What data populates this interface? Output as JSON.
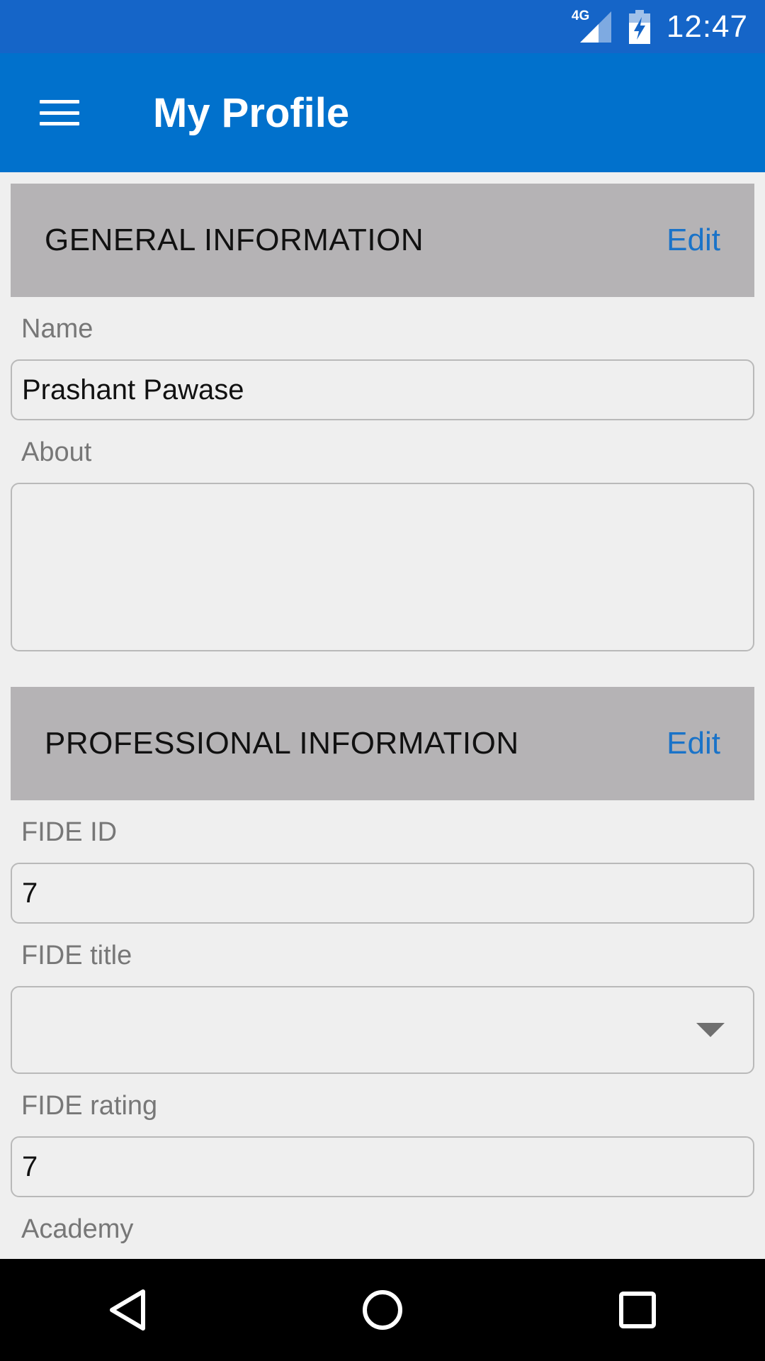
{
  "status_bar": {
    "network_label": "4G",
    "time": "12:47"
  },
  "app_bar": {
    "title": "My Profile"
  },
  "general_section": {
    "title": "GENERAL INFORMATION",
    "edit_label": "Edit",
    "name_label": "Name",
    "name_value": "Prashant Pawase",
    "about_label": "About",
    "about_value": ""
  },
  "professional_section": {
    "title": "PROFESSIONAL INFORMATION",
    "edit_label": "Edit",
    "fide_id_label": "FIDE ID",
    "fide_id_value": "7",
    "fide_title_label": "FIDE title",
    "fide_title_value": "",
    "fide_rating_label": "FIDE rating",
    "fide_rating_value": "7",
    "academy_label": "Academy"
  },
  "colors": {
    "status_bar": "#1565c8",
    "app_bar": "#0171cc",
    "section_header": "#b5b3b5",
    "accent": "#1a73c8",
    "background": "#efefef"
  }
}
